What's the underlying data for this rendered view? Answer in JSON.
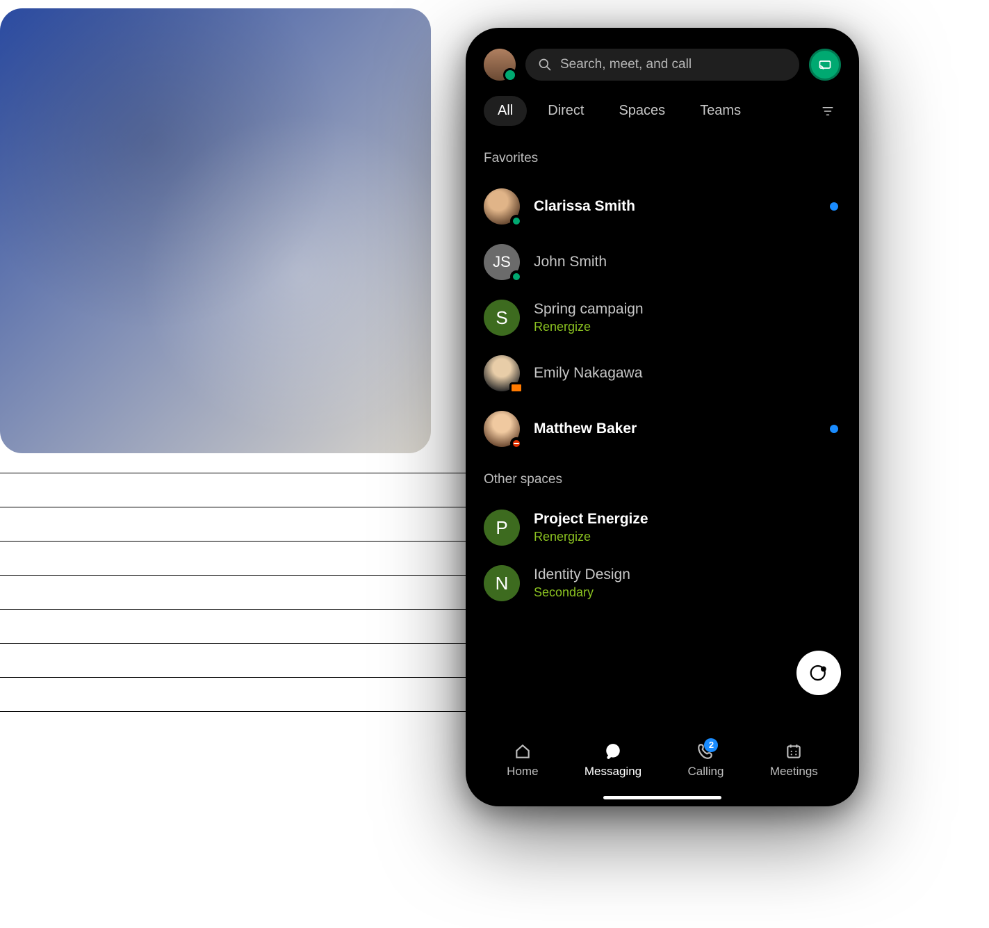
{
  "search": {
    "placeholder": "Search, meet, and call"
  },
  "tabs": {
    "all": "All",
    "direct": "Direct",
    "spaces": "Spaces",
    "teams": "Teams"
  },
  "sections": {
    "favorites": "Favorites",
    "other": "Other spaces"
  },
  "favorites": [
    {
      "name": "Clarissa Smith",
      "unread": true,
      "presence": "active"
    },
    {
      "name": "John Smith",
      "initials": "JS",
      "presence": "active"
    },
    {
      "name": "Spring campaign",
      "sub": "Renergize",
      "letter": "S",
      "space": true
    },
    {
      "name": "Emily Nakagawa",
      "presence": "camera"
    },
    {
      "name": "Matthew Baker",
      "unread": true,
      "presence": "dnd"
    }
  ],
  "other": [
    {
      "name": "Project Energize",
      "sub": "Renergize",
      "letter": "P",
      "space": true,
      "unread": true
    },
    {
      "name": "Identity Design",
      "sub": "Secondary",
      "letter": "N",
      "space": true
    }
  ],
  "nav": {
    "home": "Home",
    "messaging": "Messaging",
    "calling": "Calling",
    "calling_badge": "2",
    "meetings": "Meetings"
  }
}
